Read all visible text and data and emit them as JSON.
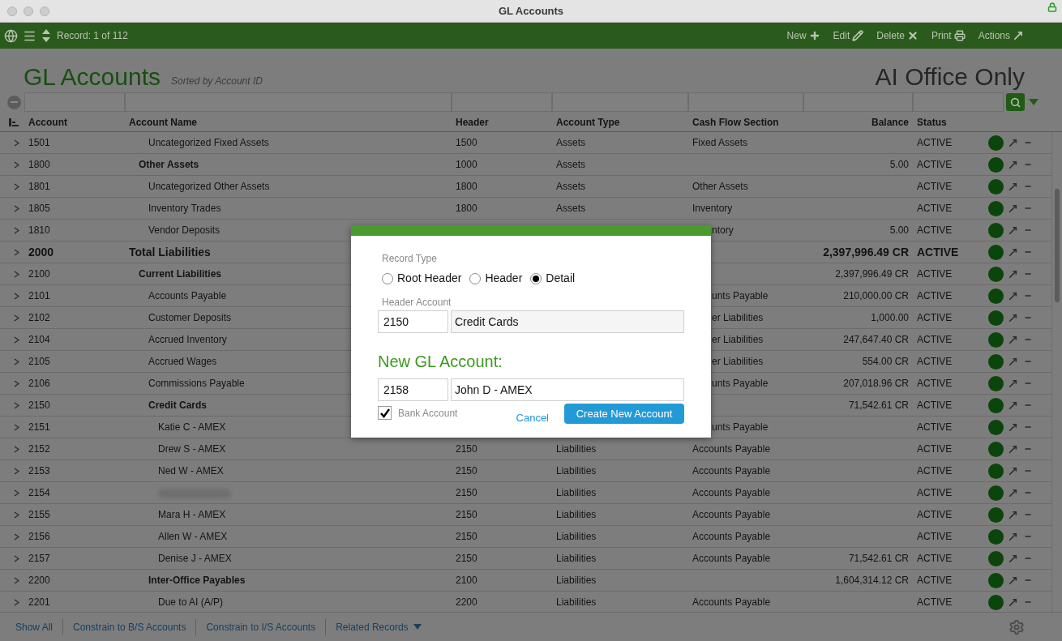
{
  "window": {
    "title": "GL Accounts"
  },
  "toolbar": {
    "record": "Record: 1 of 112",
    "actions": [
      {
        "label": "New",
        "kind": "new"
      },
      {
        "label": "Edit",
        "kind": "edit"
      },
      {
        "label": "Delete",
        "kind": "delete"
      },
      {
        "label": "Print",
        "kind": "print"
      },
      {
        "label": "Actions",
        "kind": "actions"
      }
    ]
  },
  "header": {
    "title": "GL Accounts",
    "subtitle": "Sorted by Account ID",
    "office": "AI Office Only"
  },
  "table": {
    "columns": [
      "Account",
      "Account Name",
      "Header",
      "Account Type",
      "Cash Flow Section",
      "Balance",
      "Status"
    ],
    "rows": [
      {
        "kind": "account",
        "account": "1501",
        "name": "Uncategorized Fixed Assets",
        "header": "1500",
        "type": "Assets",
        "cash_flow": "Fixed Assets",
        "status": "ACTIVE"
      },
      {
        "kind": "group",
        "account": "1800",
        "name": "Other Assets",
        "header": "1000",
        "type": "Assets",
        "balance": "5.00",
        "status": "ACTIVE"
      },
      {
        "kind": "account",
        "account": "1801",
        "name": "Uncategorized Other Assets",
        "header": "1800",
        "type": "Assets",
        "cash_flow": "Other Assets",
        "status": "ACTIVE"
      },
      {
        "kind": "account",
        "account": "1805",
        "name": "Inventory Trades",
        "header": "1800",
        "type": "Assets",
        "cash_flow": "Inventory",
        "status": "ACTIVE"
      },
      {
        "kind": "account",
        "account": "1810",
        "name": "Vendor Deposits",
        "cash_flow_cut": "ntory",
        "balance": "5.00",
        "status": "ACTIVE"
      },
      {
        "kind": "total",
        "account": "2000",
        "name": "Total Liabilities",
        "balance": "2,397,996.49 CR",
        "status": "ACTIVE"
      },
      {
        "kind": "group",
        "account": "2100",
        "name": "Current Liabilities",
        "balance": "2,397,996.49 CR",
        "status": "ACTIVE"
      },
      {
        "kind": "account",
        "account": "2101",
        "name": "Accounts Payable",
        "cash_flow_cut": "unts Payable",
        "balance": "210,000.00 CR",
        "status": "ACTIVE"
      },
      {
        "kind": "account",
        "account": "2102",
        "name": "Customer Deposits",
        "cash_flow_cut": "er Liabilities",
        "balance": "1,000.00",
        "status": "ACTIVE"
      },
      {
        "kind": "account",
        "account": "2104",
        "name": "Accrued Inventory",
        "cash_flow_cut": "er Liabilities",
        "balance": "247,647.40 CR",
        "status": "ACTIVE"
      },
      {
        "kind": "account",
        "account": "2105",
        "name": "Accrued Wages",
        "cash_flow_cut": "er Liabilities",
        "balance": "554.00 CR",
        "status": "ACTIVE"
      },
      {
        "kind": "account",
        "account": "2106",
        "name": "Commissions Payable",
        "cash_flow_cut": "unts Payable",
        "balance": "207,018.96 CR",
        "status": "ACTIVE"
      },
      {
        "kind": "subgroup",
        "account": "2150",
        "name": "Credit Cards",
        "balance": "71,542.61 CR",
        "status": "ACTIVE"
      },
      {
        "kind": "subaccount",
        "account": "2151",
        "name": "Katie C - AMEX",
        "cash_flow_cut": "unts Payable",
        "status": "ACTIVE"
      },
      {
        "kind": "subaccount",
        "account": "2152",
        "name": "Drew S - AMEX",
        "header": "2150",
        "type": "Liabilities",
        "cash_flow": "Accounts Payable",
        "status": "ACTIVE"
      },
      {
        "kind": "subaccount",
        "account": "2153",
        "name": "Ned W - AMEX",
        "header": "2150",
        "type": "Liabilities",
        "cash_flow": "Accounts Payable",
        "status": "ACTIVE"
      },
      {
        "kind": "subaccount",
        "account": "2154",
        "header": "2150",
        "type": "Liabilities",
        "cash_flow": "Accounts Payable",
        "status": "ACTIVE"
      },
      {
        "kind": "subaccount",
        "account": "2155",
        "name": "Mara H - AMEX",
        "header": "2150",
        "type": "Liabilities",
        "cash_flow": "Accounts Payable",
        "status": "ACTIVE"
      },
      {
        "kind": "subaccount",
        "account": "2156",
        "name": "Allen W - AMEX",
        "header": "2150",
        "type": "Liabilities",
        "cash_flow": "Accounts Payable",
        "status": "ACTIVE"
      },
      {
        "kind": "subaccount",
        "account": "2157",
        "name": "Denise J - AMEX",
        "header": "2150",
        "type": "Liabilities",
        "cash_flow": "Accounts Payable",
        "balance": "71,542.61 CR",
        "status": "ACTIVE"
      },
      {
        "kind": "subgroup",
        "account": "2200",
        "name": "Inter-Office Payables",
        "header": "2100",
        "type": "Liabilities",
        "balance": "1,604,314.12 CR",
        "status": "ACTIVE"
      },
      {
        "kind": "subaccount",
        "account": "2201",
        "name": "Due to AI (A/P)",
        "header": "2200",
        "type": "Liabilities",
        "cash_flow": "Accounts Payable",
        "status": "ACTIVE"
      }
    ]
  },
  "dialog": {
    "record_type_label": "Record Type",
    "record_types": [
      {
        "label": "Root Header",
        "selected": false
      },
      {
        "label": "Header",
        "selected": false
      },
      {
        "label": "Detail",
        "selected": true
      }
    ],
    "header_account_label": "Header Account",
    "header_account_id": "2150",
    "header_account_name": "Credit Cards",
    "new_title": "New GL Account:",
    "new_id": "2158",
    "new_name": "John D - AMEX",
    "bank_account": {
      "label": "Bank Account",
      "checked": true
    },
    "cancel": "Cancel",
    "create": "Create New Account"
  },
  "footer": {
    "links": [
      {
        "label": "Show All",
        "kind": "link"
      },
      {
        "label": "Constrain to B/S Accounts",
        "kind": "link"
      },
      {
        "label": "Constrain to I/S Accounts",
        "kind": "link"
      },
      {
        "label": "Related Records",
        "kind": "menu"
      }
    ]
  }
}
